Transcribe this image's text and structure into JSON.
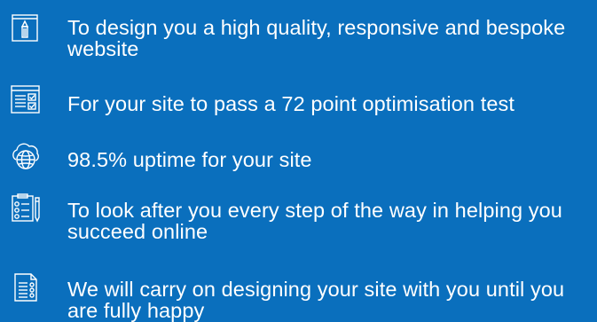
{
  "features": [
    {
      "icon": "pencil-frame-icon",
      "text": "To design you a high quality, responsive and bespoke website"
    },
    {
      "icon": "checklist-window-icon",
      "text": "For your site to pass a 72 point optimisation test"
    },
    {
      "icon": "cloud-globe-icon",
      "text": "98.5% uptime for your site"
    },
    {
      "icon": "clipboard-pen-icon",
      "text": "To look after you every step of the way in helping you succeed online"
    },
    {
      "icon": "document-settings-icon",
      "text": "We will carry on designing your site with you until you are fully happy"
    }
  ],
  "colors": {
    "background": "#0a6fbd",
    "text": "#ffffff",
    "icon_stroke": "#ffffff"
  }
}
